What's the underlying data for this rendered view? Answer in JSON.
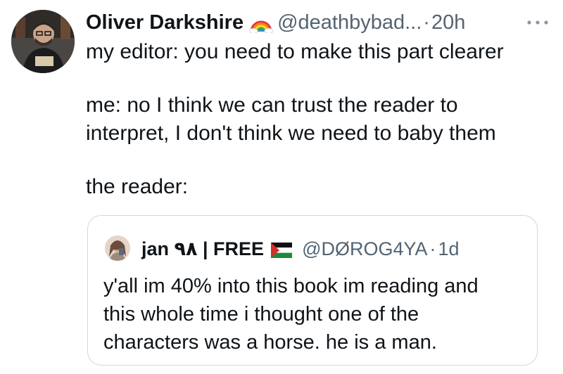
{
  "tweet": {
    "author_name": "Oliver Darkshire",
    "badge_icon": "rainbow-emoji",
    "handle": "@deathbybad...",
    "separator": "·",
    "time": "20h",
    "more_icon": "more-horizontal-icon",
    "text_lines": [
      "my editor: you need to make this part clearer",
      "me: no I think we can trust the reader to",
      "interpret, I don't think we need to baby them",
      "the reader:"
    ]
  },
  "quote": {
    "author_name": "jan ٩٨ | FREE",
    "flag_icon": "palestine-flag-emoji",
    "handle": "@DØROG4YA",
    "separator": "·",
    "time": "1d",
    "text_lines": [
      "y'all im 40% into this book im reading and",
      "this whole time i thought one of the",
      "characters was a horse. he is a man."
    ]
  },
  "colors": {
    "text_primary": "#0f1419",
    "text_secondary": "#536471",
    "border": "#cfd9de"
  }
}
